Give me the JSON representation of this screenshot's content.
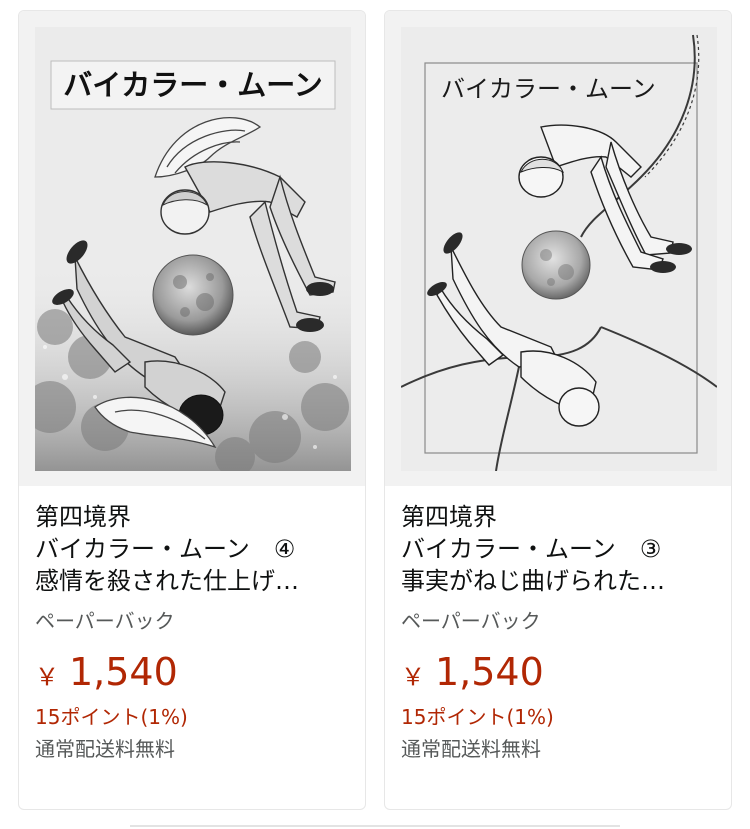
{
  "products": [
    {
      "cover_title": "バイカラー・ムーン",
      "author": "第四境界",
      "title_line_1": "バイカラー・ムーン　④",
      "title_line_2": "感情を殺された仕上げ…",
      "format": "ペーパーバック",
      "currency": "￥",
      "price": "1,540",
      "points": "15ポイント(1%)",
      "shipping": "通常配送料無料"
    },
    {
      "cover_title": "バイカラー・ムーン",
      "author": "第四境界",
      "title_line_1": "バイカラー・ムーン　③",
      "title_line_2": "事実がねじ曲げられた…",
      "format": "ペーパーバック",
      "currency": "￥",
      "price": "1,540",
      "points": "15ポイント(1%)",
      "shipping": "通常配送料無料"
    }
  ],
  "colors": {
    "price": "#b12704",
    "text": "#0f1111",
    "muted": "#565959",
    "card_border": "#e7e7e7"
  }
}
